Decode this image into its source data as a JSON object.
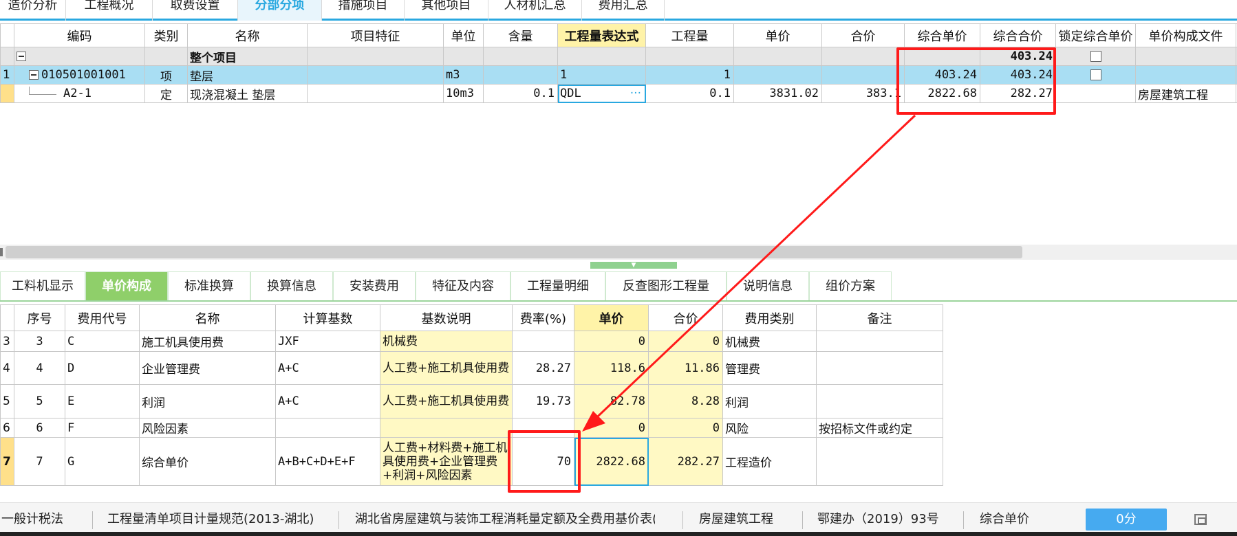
{
  "top_tabs": [
    {
      "label": "造价分析"
    },
    {
      "label": "工程概况"
    },
    {
      "label": "取费设置"
    },
    {
      "label": "分部分项",
      "active": true
    },
    {
      "label": "措施项目"
    },
    {
      "label": "其他项目"
    },
    {
      "label": "人材机汇总"
    },
    {
      "label": "费用汇总"
    }
  ],
  "upper_table": {
    "headers": [
      "编码",
      "类别",
      "名称",
      "项目特征",
      "单位",
      "含量",
      "工程量表达式",
      "工程量",
      "单价",
      "合价",
      "综合单价",
      "综合合价",
      "锁定综合单价",
      "单价构成文件"
    ],
    "rows": [
      {
        "index": "",
        "code": "",
        "type": "",
        "name": "整个项目",
        "feature": "",
        "unit": "",
        "content": "",
        "expr": "",
        "qty": "",
        "price": "",
        "total": "",
        "comp_price": "",
        "comp_total": "403.24",
        "locked": false
      },
      {
        "index": "1",
        "code": "010501001001",
        "type": "项",
        "name": "垫层",
        "feature": "",
        "unit": "m3",
        "content": "",
        "expr": "1",
        "qty": "1",
        "price": "",
        "total": "",
        "comp_price": "403.24",
        "comp_total": "403.24",
        "locked": false
      },
      {
        "index": "",
        "code": "A2-1",
        "type": "定",
        "name": "现浇混凝土 垫层",
        "feature": "",
        "unit": "10m3",
        "content": "0.1",
        "expr": "QDL",
        "qty": "0.1",
        "price": "3831.02",
        "total": "383.1",
        "comp_price": "2822.68",
        "comp_total": "282.27",
        "file": "房屋建筑工程"
      }
    ],
    "expr_button": "···"
  },
  "sub_tabs": [
    {
      "label": "工料机显示"
    },
    {
      "label": "单价构成",
      "active": true
    },
    {
      "label": "标准换算"
    },
    {
      "label": "换算信息"
    },
    {
      "label": "安装费用"
    },
    {
      "label": "特征及内容"
    },
    {
      "label": "工程量明细"
    },
    {
      "label": "反查图形工程量"
    },
    {
      "label": "说明信息"
    },
    {
      "label": "组价方案"
    }
  ],
  "lower_table": {
    "headers": [
      "序号",
      "费用代号",
      "名称",
      "计算基数",
      "基数说明",
      "费率(%)",
      "单价",
      "合价",
      "费用类别",
      "备注"
    ],
    "rows": [
      {
        "index": "3",
        "seq": "3",
        "code": "C",
        "name": "施工机具使用费",
        "base": "JXF",
        "desc": "机械费",
        "rate": "",
        "price": "0",
        "total": "0",
        "category": "机械费",
        "note": ""
      },
      {
        "index": "4",
        "seq": "4",
        "code": "D",
        "name": "企业管理费",
        "base": "A+C",
        "desc": "人工费+施工机具使用费",
        "rate": "28.27",
        "price": "118.6",
        "total": "11.86",
        "category": "管理费",
        "note": ""
      },
      {
        "index": "5",
        "seq": "5",
        "code": "E",
        "name": "利润",
        "base": "A+C",
        "desc": "人工费+施工机具使用费",
        "rate": "19.73",
        "price": "82.78",
        "total": "8.28",
        "category": "利润",
        "note": ""
      },
      {
        "index": "6",
        "seq": "6",
        "code": "F",
        "name": "风险因素",
        "base": "",
        "desc": "",
        "rate": "",
        "price": "0",
        "total": "0",
        "category": "风险",
        "note": "按招标文件或约定"
      },
      {
        "index": "7",
        "seq": "7",
        "code": "G",
        "name": "综合单价",
        "base": "A+B+C+D+E+F",
        "desc": "人工费+材料费+施工机具使用费+企业管理费+利润+风险因素",
        "rate": "70",
        "price": "2822.68",
        "total": "282.27",
        "category": "工程造价",
        "note": ""
      }
    ]
  },
  "status_bar": {
    "items": [
      "一般计税法",
      "工程量清单项目计量规范(2013-湖北)",
      "湖北省房屋建筑与装饰工程消耗量定额及全费用基价表(",
      "房屋建筑工程",
      "鄂建办（2019）93号",
      "综合单价"
    ],
    "score": "0分"
  },
  "colors": {
    "accent": "#29a8e0",
    "selected_row": "#a9def3",
    "annotation": "#ff1a1a",
    "tab_green": "#8fcf6a"
  }
}
